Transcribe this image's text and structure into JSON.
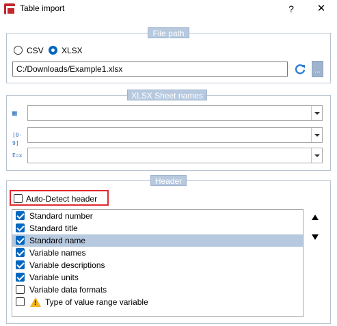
{
  "window": {
    "title": "Table import",
    "help_label": "?",
    "close_label": "✕",
    "app_icon": "table-import-app-icon"
  },
  "file_path": {
    "group_title": "File path",
    "format_options": [
      {
        "label": "CSV",
        "selected": false
      },
      {
        "label": "XLSX",
        "selected": true
      }
    ],
    "path_value": "C:/Downloads/Example1.xlsx",
    "browse_label": "...",
    "refresh_icon": "refresh-icon"
  },
  "sheet_names": {
    "group_title": "XLSX Sheet names",
    "rows": [
      {
        "icon": "table-icon",
        "icon_text": "▦",
        "value": ""
      },
      {
        "icon": "numeric-range-icon",
        "icon_text": "[0-9]",
        "value": ""
      },
      {
        "icon": "expression-icon",
        "icon_text": "E=x",
        "value": ""
      }
    ]
  },
  "header": {
    "group_title": "Header",
    "auto_detect_label": "Auto-Detect header",
    "auto_detect_checked": false,
    "items": [
      {
        "label": "Standard number",
        "checked": true,
        "selected": false
      },
      {
        "label": "Standard title",
        "checked": true,
        "selected": false
      },
      {
        "label": "Standard name",
        "checked": true,
        "selected": true
      },
      {
        "label": "Variable names",
        "checked": true,
        "selected": false
      },
      {
        "label": "Variable descriptions",
        "checked": true,
        "selected": false
      },
      {
        "label": "Variable units",
        "checked": true,
        "selected": false
      },
      {
        "label": "Variable data formats",
        "checked": false,
        "selected": false
      },
      {
        "label": "Type of value range variable",
        "checked": false,
        "selected": false,
        "warning": true
      }
    ],
    "move_up_icon": "triangle-up-icon",
    "move_down_icon": "triangle-down-icon"
  },
  "colors": {
    "accent": "#0067c0",
    "group_title_bg": "#b7c9df",
    "highlight_border": "#e0282d",
    "warning": "#f2b51c",
    "app_icon": "#c0282d"
  }
}
